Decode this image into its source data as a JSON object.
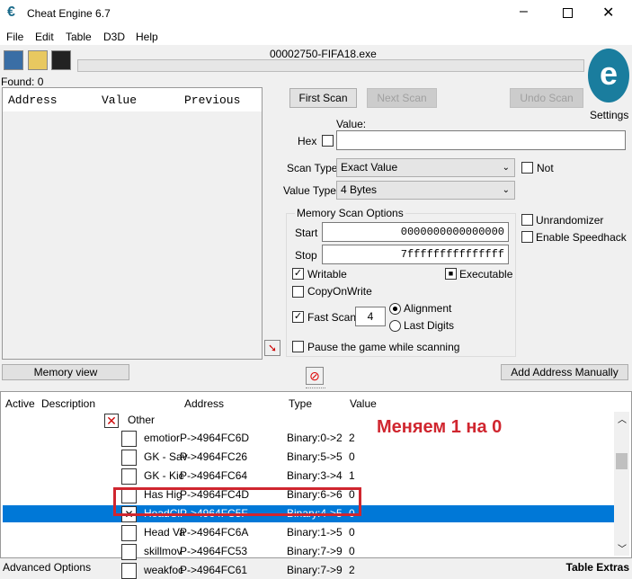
{
  "window": {
    "title": "Cheat Engine 6.7"
  },
  "menu": [
    "File",
    "Edit",
    "Table",
    "D3D",
    "Help"
  ],
  "process_name": "00002750-FIFA18.exe",
  "found": "Found: 0",
  "results_columns": [
    "Address",
    "Value",
    "Previous"
  ],
  "scan": {
    "first_scan": "First Scan",
    "next_scan": "Next Scan",
    "undo_scan": "Undo Scan",
    "settings": "Settings",
    "value_label": "Value:",
    "hex_label": "Hex",
    "value": "",
    "scan_type_label": "Scan Type",
    "scan_type": "Exact Value",
    "not_label": "Not",
    "value_type_label": "Value Type",
    "value_type": "4 Bytes",
    "mem_options_title": "Memory Scan Options",
    "start_label": "Start",
    "start": "0000000000000000",
    "stop_label": "Stop",
    "stop": "7fffffffffffffff",
    "writable": "Writable",
    "executable": "Executable",
    "copy_on_write": "CopyOnWrite",
    "fast_scan": "Fast Scan",
    "fast_scan_value": "4",
    "alignment": "Alignment",
    "last_digits": "Last Digits",
    "pause": "Pause the game while scanning",
    "unrandomizer": "Unrandomizer",
    "speedhack": "Enable Speedhack"
  },
  "memory_view": "Memory view",
  "add_address": "Add Address Manually",
  "table": {
    "columns": [
      "Active",
      "Description",
      "Address",
      "Type",
      "Value"
    ],
    "group": "Other",
    "rows": [
      {
        "desc": "emotior",
        "address": "P->4964FC6D",
        "type": "Binary:0->2",
        "value": "2"
      },
      {
        "desc": "GK - Sav",
        "address": "P->4964FC26",
        "type": "Binary:5->5",
        "value": "0"
      },
      {
        "desc": "GK - Kic",
        "address": "P->4964FC64",
        "type": "Binary:3->4",
        "value": "1"
      },
      {
        "desc": "Has Hig",
        "address": "P->4964FC4D",
        "type": "Binary:6->6",
        "value": "0"
      },
      {
        "desc": "HeadCl",
        "address": "P->4964FC5F",
        "type": "Binary:4->5",
        "value": "0"
      },
      {
        "desc": "Head Va",
        "address": "P->4964FC6A",
        "type": "Binary:1->5",
        "value": "0"
      },
      {
        "desc": "skillmov",
        "address": "P->4964FC53",
        "type": "Binary:7->9",
        "value": "0"
      },
      {
        "desc": "weakfoc",
        "address": "P->4964FC61",
        "type": "Binary:7->9",
        "value": "2"
      }
    ]
  },
  "annotation": "Меняем 1 на 0",
  "footer": {
    "advanced": "Advanced Options",
    "extras": "Table Extras"
  },
  "colors": {
    "selection": "#0078d7",
    "annotation": "#d0262f"
  }
}
